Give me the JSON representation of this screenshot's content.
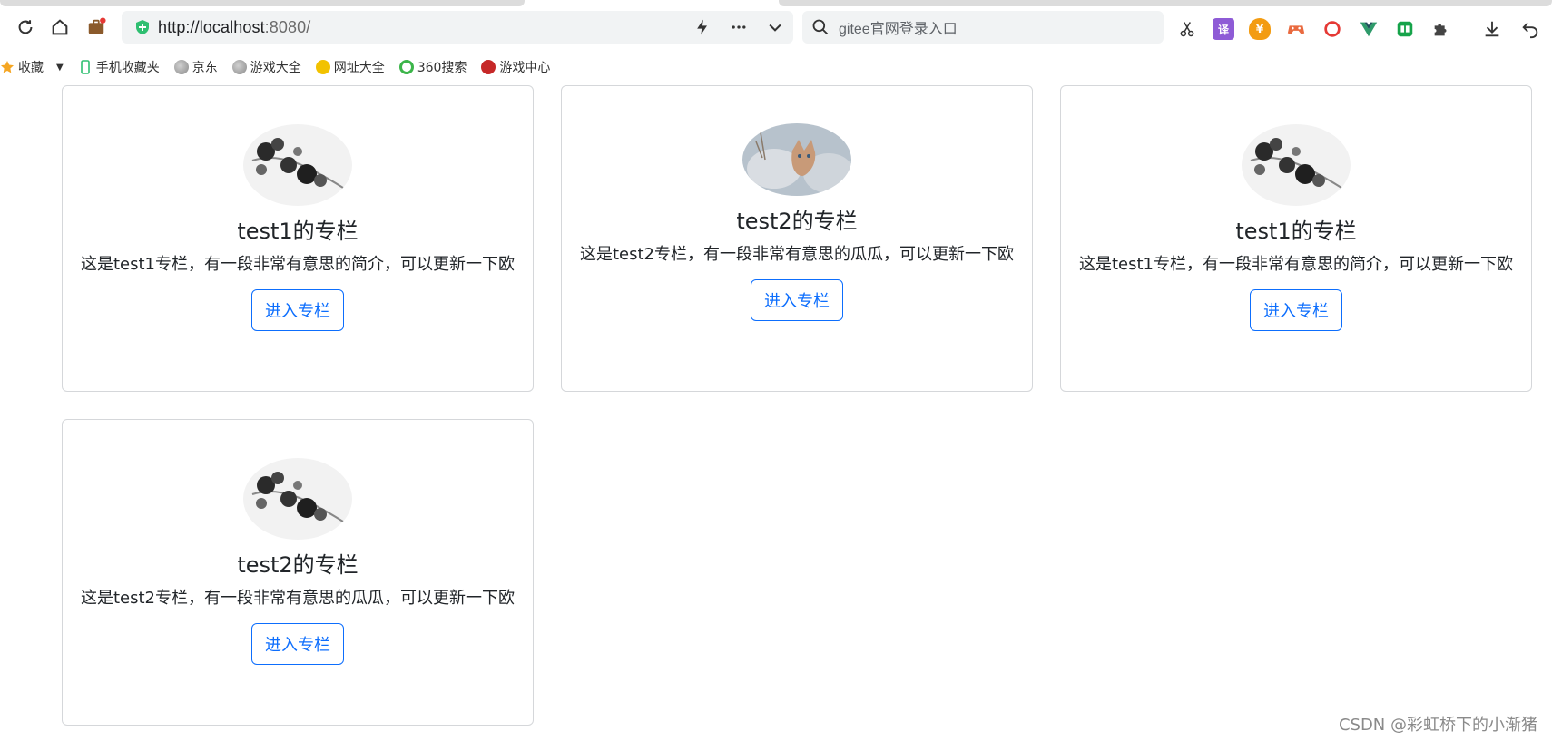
{
  "browser": {
    "address_bar": {
      "scheme_host": "http://localhost",
      "port_path": ":8080/"
    },
    "search": {
      "placeholder": "gitee官网登录入口"
    },
    "bookmarks": [
      {
        "label": "收藏",
        "icon": "star-icon"
      },
      {
        "label": "手机收藏夹",
        "icon": "phone-icon"
      },
      {
        "label": "京东",
        "icon": "globe-icon"
      },
      {
        "label": "游戏大全",
        "icon": "globe-icon"
      },
      {
        "label": "网址大全",
        "icon": "arrows-icon"
      },
      {
        "label": "360搜索",
        "icon": "search-ring-icon"
      },
      {
        "label": "游戏中心",
        "icon": "game-icon"
      }
    ],
    "extensions": [
      {
        "icon": "scissors-icon"
      },
      {
        "icon": "translate-icon",
        "glyph": "译",
        "color": "#8e5bd6"
      },
      {
        "icon": "yen-icon",
        "glyph": "¥",
        "color": "#f39c12"
      },
      {
        "icon": "gamepad-icon",
        "color": "#e96a3f"
      },
      {
        "icon": "ring-icon",
        "color": "#e53935"
      },
      {
        "icon": "vue-icon",
        "color": "#2e9a6a"
      },
      {
        "icon": "book-icon",
        "color": "#16a34a"
      },
      {
        "icon": "puzzle-icon"
      }
    ]
  },
  "cards": [
    {
      "title": "test1的专栏",
      "text": "这是test1专栏，有一段非常有意思的简介，可以更新一下欧",
      "button": "进入专栏",
      "avatar": "ink-flower-avatar"
    },
    {
      "title": "test2的专栏",
      "text": "这是test2专栏，有一段非常有意思的瓜瓜，可以更新一下欧",
      "button": "进入专栏",
      "avatar": "cat-avatar"
    },
    {
      "title": "test1的专栏",
      "text": "这是test1专栏，有一段非常有意思的简介，可以更新一下欧",
      "button": "进入专栏",
      "avatar": "ink-flower-avatar"
    },
    {
      "title": "test2的专栏",
      "text": "这是test2专栏，有一段非常有意思的瓜瓜，可以更新一下欧",
      "button": "进入专栏",
      "avatar": "ink-flower-avatar"
    }
  ],
  "watermark": "CSDN @彩虹桥下的小渐猪"
}
